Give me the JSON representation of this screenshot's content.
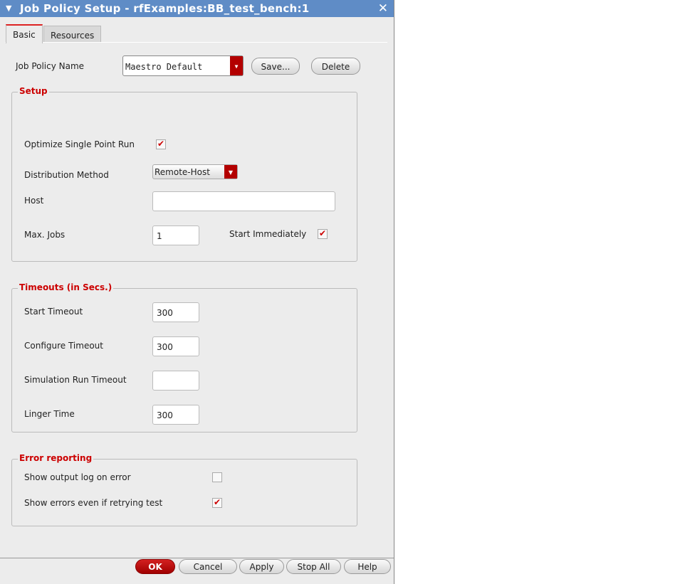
{
  "title": "Job Policy Setup - rfExamples:BB_test_bench:1",
  "tabs": [
    "Basic",
    "Resources"
  ],
  "job_policy": {
    "label": "Job Policy Name",
    "value": "Maestro Default",
    "save": "Save...",
    "delete": "Delete"
  },
  "setup": {
    "title": "Setup",
    "optimize_label": "Optimize Single Point Run",
    "optimize_checked": true,
    "dist_label": "Distribution Method",
    "dist_value": "Remote-Host",
    "host_label": "Host",
    "host_value": "",
    "maxjobs_label": "Max. Jobs",
    "maxjobs_value": "1",
    "start_label": "Start Immediately",
    "start_checked": true
  },
  "timeouts": {
    "title": "Timeouts (in Secs.)",
    "start_label": "Start Timeout",
    "start_value": "300",
    "config_label": "Configure Timeout",
    "config_value": "300",
    "sim_label": "Simulation Run Timeout",
    "sim_value": "",
    "linger_label": "Linger Time",
    "linger_value": "300"
  },
  "errors": {
    "title": "Error reporting",
    "log_label": "Show output log on error",
    "log_checked": false,
    "retry_label": "Show errors even if retrying test",
    "retry_checked": true
  },
  "buttons": {
    "ok": "OK",
    "cancel": "Cancel",
    "apply": "Apply",
    "stop_all": "Stop All",
    "help": "Help"
  },
  "icons": {
    "check": "✔",
    "dropdown": "▼",
    "close": "✕"
  }
}
